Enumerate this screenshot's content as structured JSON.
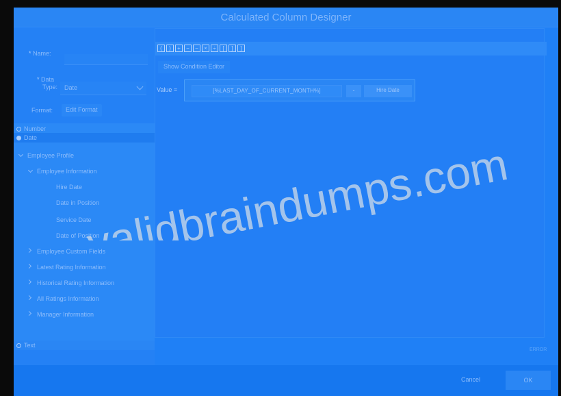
{
  "dialog": {
    "title": "Calculated Column Designer"
  },
  "form": {
    "name_label": "Name:",
    "data_type_label_1": "Data",
    "data_type_label_2": "Type:",
    "data_type_value": "Date",
    "format_label": "Format:",
    "edit_format_label": "Edit Format"
  },
  "tree": {
    "number": "Number",
    "date": "Date",
    "employee_profile": "Employee Profile",
    "employee_information": "Employee Information",
    "hire_date": "Hire Date",
    "date_in_position": "Date in Position",
    "service_date": "Service Date",
    "date_of_position": "Date of Position",
    "employee_custom_fields": "Employee Custom Fields",
    "latest_rating_information": "Latest Rating Information",
    "historical_rating_information": "Historical Rating Information",
    "all_ratings_information": "All Ratings Information",
    "manager_information": "Manager Information",
    "text": "Text"
  },
  "editor": {
    "show_condition_editor": "Show Condition Editor",
    "value_label": "Value =",
    "expression_token": "[%LAST_DAY_OF_CURRENT_MONTH%]",
    "operator": "-",
    "field_token": "Hire Date",
    "error_label": "ERROR"
  },
  "toolbar_icons": [
    "open-bracket-icon",
    "close-bracket-icon",
    "plus-icon",
    "minus-icon",
    "multiply-icon",
    "divide-icon",
    "bracket-left-icon",
    "bracket-right-icon"
  ],
  "footer": {
    "cancel_label": "Cancel",
    "ok_label": "OK"
  },
  "watermark": {
    "text": "ee.validbraindumps.com"
  },
  "colors": {
    "overlay_blue": "#1f80f6",
    "background": "#0a0a0a"
  }
}
